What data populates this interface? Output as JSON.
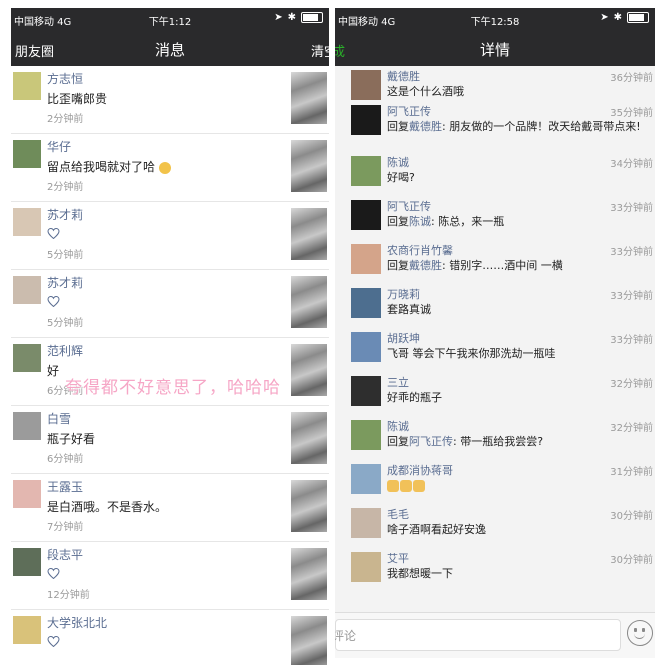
{
  "left": {
    "status": {
      "carrier": "中国移动  4G",
      "time": "下午1:12"
    },
    "nav": {
      "back": "朋友圈",
      "title": "消息",
      "right": "清空"
    },
    "messages": [
      {
        "name": "方志恒",
        "content": "比歪嘴郎贵",
        "time": "2分钟前",
        "heart": false
      },
      {
        "name": "华仔",
        "content": "留点给我喝就对了哈",
        "time": "2分钟前",
        "heart": false,
        "emoji": true
      },
      {
        "name": "苏才莉",
        "content": "",
        "time": "5分钟前",
        "heart": true
      },
      {
        "name": "苏才莉",
        "content": "",
        "time": "5分钟前",
        "heart": true
      },
      {
        "name": "范利辉",
        "content": "好",
        "time": "6分钟前",
        "heart": false
      },
      {
        "name": "白雪",
        "content": "瓶子好看",
        "time": "6分钟前",
        "heart": false
      },
      {
        "name": "王露玉",
        "content": "是白酒哦。不是香水。",
        "time": "7分钟前",
        "heart": false
      },
      {
        "name": "段志平",
        "content": "",
        "time": "12分钟前",
        "heart": true
      },
      {
        "name": "大学张北北",
        "content": "",
        "time": "",
        "heart": true
      }
    ],
    "overlay": "夸得都不好意思了，哈哈哈"
  },
  "right": {
    "status": {
      "carrier": "中国移动  4G",
      "time": "下午12:58"
    },
    "nav": {
      "back": "成",
      "title": "详情"
    },
    "comments": [
      {
        "name": "戴德胜",
        "content": "这是个什么酒哦",
        "time": "36分钟前",
        "size": "short"
      },
      {
        "name": "阿飞正传",
        "reply_prefix": "回复",
        "reply_to": "戴德胜",
        "content": ": 朋友做的一个品牌！改天给戴哥带点来!",
        "time": "35分钟前",
        "size": "tall"
      },
      {
        "name": "陈诚",
        "content": "好喝?",
        "time": "34分钟前"
      },
      {
        "name": "阿飞正传",
        "reply_prefix": "回复",
        "reply_to": "陈诚",
        "content": ": 陈总，来一瓶",
        "time": "33分钟前"
      },
      {
        "name": "农商行肖竹馨",
        "reply_prefix": "回复",
        "reply_to": "戴德胜",
        "content": ": 错别字……酒中间  一横",
        "time": "33分钟前"
      },
      {
        "name": "万晓莉",
        "content": "套路真诚",
        "time": "33分钟前"
      },
      {
        "name": "胡跃坤",
        "content": "飞哥 等会下午我来你那洗劫一瓶哇",
        "time": "33分钟前"
      },
      {
        "name": "三立",
        "content": "好乖的瓶子",
        "time": "32分钟前"
      },
      {
        "name": "陈诚",
        "reply_prefix": "回复",
        "reply_to": "阿飞正传",
        "content": ": 带一瓶给我尝尝?",
        "time": "32分钟前"
      },
      {
        "name": "成都消协蒋哥",
        "content": "",
        "time": "31分钟前",
        "thumbs": true
      },
      {
        "name": "毛毛",
        "content": "啥子酒啊看起好安逸",
        "time": "30分钟前"
      },
      {
        "name": "艾平",
        "content": "我都想暖一下",
        "time": "30分钟前"
      }
    ],
    "comment_placeholder": "评论"
  },
  "colors": {
    "bar": "#2a2a2c",
    "link": "#5a6d91",
    "green": "#2aae2a"
  }
}
